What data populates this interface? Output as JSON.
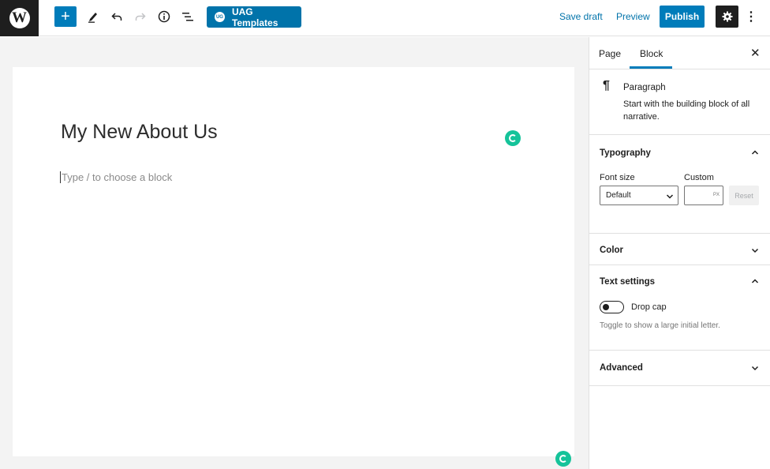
{
  "toolbar": {
    "logo_icon": "wordpress-logo",
    "add_block_icon": "plus-icon",
    "tools_icon": "pencil-icon",
    "undo_icon": "undo-icon",
    "redo_icon": "redo-icon",
    "info_icon": "info-icon",
    "list_view_icon": "list-view-icon",
    "uag_logo_text": "UG",
    "uag_label": "UAG Templates",
    "save_draft_label": "Save draft",
    "preview_label": "Preview",
    "publish_label": "Publish",
    "settings_icon": "gear-icon",
    "more_icon": "more-vertical-icon",
    "brand_color": "#007cba"
  },
  "editor": {
    "title": "My New About Us",
    "placeholder": "Type / to choose a block",
    "grammarly_color": "#15c39a"
  },
  "sidebar": {
    "tabs": [
      {
        "label": "Page",
        "active": false
      },
      {
        "label": "Block",
        "active": true
      }
    ],
    "close_icon": "close-icon",
    "block_card": {
      "icon": "pilcrow-icon",
      "name": "Paragraph",
      "description": "Start with the building block of all narrative."
    },
    "typography": {
      "title": "Typography",
      "expanded": true,
      "font_size_label": "Font size",
      "font_size_value": "Default",
      "custom_label": "Custom",
      "custom_value": "",
      "custom_unit": "PX",
      "reset_label": "Reset"
    },
    "color": {
      "title": "Color",
      "expanded": false
    },
    "text_settings": {
      "title": "Text settings",
      "expanded": true,
      "drop_cap_label": "Drop cap",
      "drop_cap_on": false,
      "help": "Toggle to show a large initial letter."
    },
    "advanced": {
      "title": "Advanced",
      "expanded": false
    }
  }
}
